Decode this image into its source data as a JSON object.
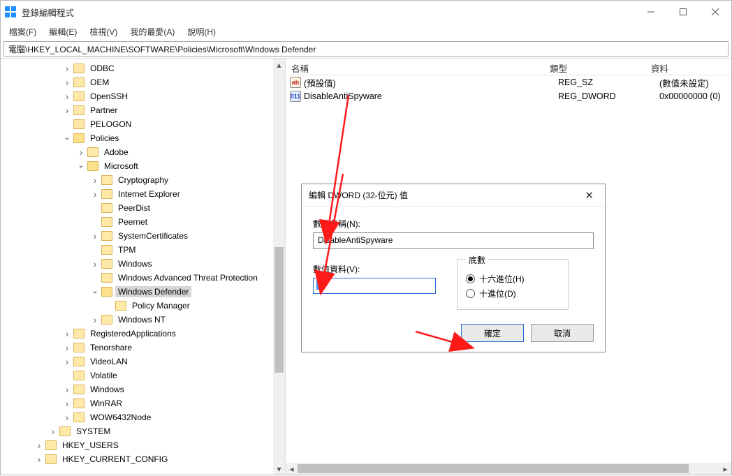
{
  "window": {
    "title": "登錄編輯程式"
  },
  "menu": {
    "items": [
      "檔案(F)",
      "編輯(E)",
      "檢視(V)",
      "我的最愛(A)",
      "說明(H)"
    ]
  },
  "address": "電腦\\HKEY_LOCAL_MACHINE\\SOFTWARE\\Policies\\Microsoft\\Windows Defender",
  "tree": {
    "items": [
      {
        "depth": 3,
        "exp": ">",
        "label": "ODBC"
      },
      {
        "depth": 3,
        "exp": ">",
        "label": "OEM"
      },
      {
        "depth": 3,
        "exp": ">",
        "label": "OpenSSH"
      },
      {
        "depth": 3,
        "exp": ">",
        "label": "Partner"
      },
      {
        "depth": 3,
        "exp": "",
        "label": "PELOGON"
      },
      {
        "depth": 3,
        "exp": "v",
        "label": "Policies",
        "open": true
      },
      {
        "depth": 4,
        "exp": ">",
        "label": "Adobe"
      },
      {
        "depth": 4,
        "exp": "v",
        "label": "Microsoft",
        "open": true
      },
      {
        "depth": 5,
        "exp": ">",
        "label": "Cryptography"
      },
      {
        "depth": 5,
        "exp": ">",
        "label": "Internet Explorer"
      },
      {
        "depth": 5,
        "exp": "",
        "label": "PeerDist"
      },
      {
        "depth": 5,
        "exp": "",
        "label": "Peernet"
      },
      {
        "depth": 5,
        "exp": ">",
        "label": "SystemCertificates"
      },
      {
        "depth": 5,
        "exp": "",
        "label": "TPM"
      },
      {
        "depth": 5,
        "exp": ">",
        "label": "Windows"
      },
      {
        "depth": 5,
        "exp": "",
        "label": "Windows Advanced Threat Protection"
      },
      {
        "depth": 5,
        "exp": "v",
        "label": "Windows Defender",
        "open": true,
        "selected": true
      },
      {
        "depth": 6,
        "exp": "",
        "label": "Policy Manager"
      },
      {
        "depth": 5,
        "exp": ">",
        "label": "Windows NT"
      },
      {
        "depth": 3,
        "exp": ">",
        "label": "RegisteredApplications"
      },
      {
        "depth": 3,
        "exp": ">",
        "label": "Tenorshare"
      },
      {
        "depth": 3,
        "exp": ">",
        "label": "VideoLAN"
      },
      {
        "depth": 3,
        "exp": "",
        "label": "Volatile"
      },
      {
        "depth": 3,
        "exp": ">",
        "label": "Windows"
      },
      {
        "depth": 3,
        "exp": ">",
        "label": "WinRAR"
      },
      {
        "depth": 3,
        "exp": ">",
        "label": "WOW6432Node"
      },
      {
        "depth": 2,
        "exp": ">",
        "label": "SYSTEM"
      },
      {
        "depth": 1,
        "exp": ">",
        "label": "HKEY_USERS"
      },
      {
        "depth": 1,
        "exp": ">",
        "label": "HKEY_CURRENT_CONFIG"
      }
    ]
  },
  "list": {
    "headers": {
      "name": "名稱",
      "type": "類型",
      "data": "資料"
    },
    "rows": [
      {
        "icon": "ab",
        "name": "(預設值)",
        "type": "REG_SZ",
        "data": "(數值未設定)"
      },
      {
        "icon": "bin",
        "name": "DisableAntiSpyware",
        "type": "REG_DWORD",
        "data": "0x00000000 (0)"
      }
    ]
  },
  "dialog": {
    "title": "編輯 DWORD (32-位元) 值",
    "name_label": "數值名稱(N):",
    "name_value": "DisableAntiSpyware",
    "data_label": "數值資料(V):",
    "data_value": "1",
    "base_label": "底數",
    "radio_hex": "十六進位(H)",
    "radio_dec": "十進位(D)",
    "ok": "確定",
    "cancel": "取消"
  }
}
